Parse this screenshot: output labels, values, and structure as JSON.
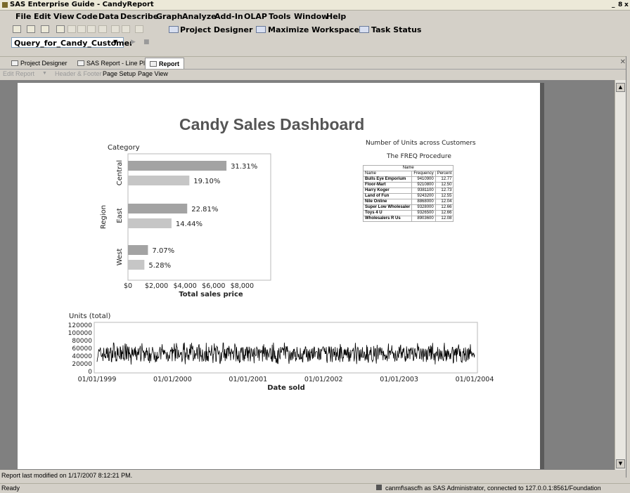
{
  "window": {
    "title": "SAS Enterprise Guide - CandyReport",
    "buttons": [
      "_",
      "8",
      "x"
    ]
  },
  "menu": [
    "File",
    "Edit",
    "View",
    "Code",
    "Data",
    "Describe",
    "Graph",
    "Analyze",
    "Add-In",
    "OLAP",
    "Tools",
    "Window",
    "Help"
  ],
  "toolbar": {
    "project_designer": "Project Designer",
    "maximize_workspace": "Maximize Workspace",
    "task_status": "Task Status"
  },
  "query": {
    "value": "Query_for_Candy_Customer"
  },
  "tabs": [
    {
      "label": "Project Designer",
      "icon": "project-designer-icon"
    },
    {
      "label": "SAS Report - Line Plot",
      "icon": "report-icon"
    },
    {
      "label": "Report",
      "icon": "report-page-icon"
    }
  ],
  "report_toolbar": [
    "Edit Report",
    "Header & Footer",
    "Page Setup",
    "Page View"
  ],
  "report": {
    "title": "Candy Sales Dashboard",
    "freq": {
      "title1": "Number of Units across Customers",
      "title2": "The FREQ Procedure",
      "group_header": "Name",
      "columns": [
        "Name",
        "Frequency",
        "Percent"
      ],
      "rows": [
        [
          "Bulls Eye Emporium",
          "9410900",
          "12.77"
        ],
        [
          "Floor-Mart",
          "9210800",
          "12.50"
        ],
        [
          "Harry Koger",
          "9381100",
          "12.73"
        ],
        [
          "Land of Fun",
          "9243200",
          "12.55"
        ],
        [
          "Nile Online",
          "8868000",
          "12.04"
        ],
        [
          "Super Low Wholesaler",
          "9328000",
          "12.66"
        ],
        [
          "Toys 4 U",
          "9326500",
          "12.66"
        ],
        [
          "Wholesalers R Us",
          "8903600",
          "12.08"
        ]
      ]
    }
  },
  "chart_data": [
    {
      "type": "bar",
      "orientation": "horizontal",
      "title": "Category",
      "xlabel": "Total sales price",
      "ylabel": "Region",
      "categories": [
        "Central",
        "East",
        "West"
      ],
      "series": [
        {
          "values": [
            31.31,
            22.81,
            7.07
          ],
          "percent_labels": [
            "31.31%",
            "22.81%",
            "7.07%"
          ],
          "color": "#a3a3a3"
        },
        {
          "values": [
            19.1,
            14.44,
            5.28
          ],
          "percent_labels": [
            "19.10%",
            "14.44%",
            "5.28%"
          ],
          "color": "#c6c6c6"
        }
      ],
      "xticks": [
        "$0",
        "$2,000",
        "$4,000",
        "$6,000",
        "$8,000"
      ],
      "xlim": [
        0,
        10000
      ],
      "bar_values_estimated": [
        [
          6900,
          4150,
          1400
        ],
        [
          4300,
          3050,
          1150
        ]
      ],
      "grid": false
    },
    {
      "type": "line",
      "title": "Units (total)",
      "xlabel": "Date sold",
      "ylabel": "",
      "xticks": [
        "01/01/1999",
        "01/01/2000",
        "01/01/2001",
        "01/01/2002",
        "01/01/2003",
        "01/01/2004"
      ],
      "yticks": [
        "0",
        "20000",
        "40000",
        "60000",
        "80000",
        "100000",
        "120000"
      ],
      "ylim": [
        0,
        120000
      ],
      "xrange": [
        "01/01/1999",
        "01/01/2004"
      ],
      "series": [
        {
          "color": "#000000",
          "typical_range": [
            25000,
            65000
          ],
          "peak": 75000
        }
      ],
      "grid": false
    }
  ],
  "status": {
    "modified": "Report last modified on 1/17/2007 8:12:21 PM.",
    "ready": "Ready",
    "connection": "canmf\\sascfh as SAS Administrator, connected to 127.0.0.1:8561/Foundation"
  }
}
